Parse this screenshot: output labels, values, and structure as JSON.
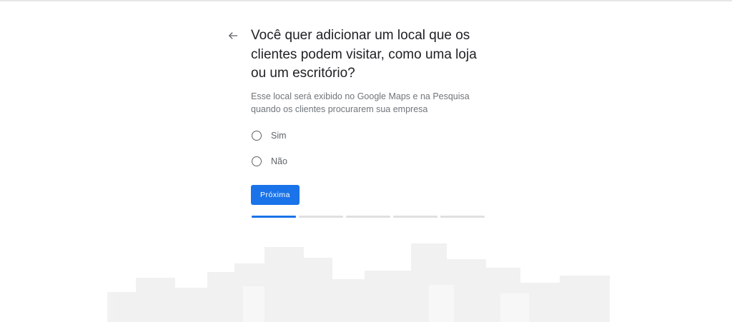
{
  "page": {
    "title": "Você quer adicionar um local que os clientes podem visitar, como uma loja ou um escritório?",
    "subtitle": "Esse local será exibido no Google Maps e na Pesquisa quando os clientes procurarem sua empresa",
    "back_icon": "arrow-left-icon"
  },
  "options": [
    {
      "label": "Sim",
      "selected": false
    },
    {
      "label": "Não",
      "selected": false
    }
  ],
  "next_button": {
    "label": "Próxima"
  },
  "progress": {
    "total_steps": 5,
    "current_step": 1
  },
  "colors": {
    "accent": "#1a73e8",
    "text": "#202124",
    "muted": "#70757a",
    "track": "#e0e0e0"
  }
}
